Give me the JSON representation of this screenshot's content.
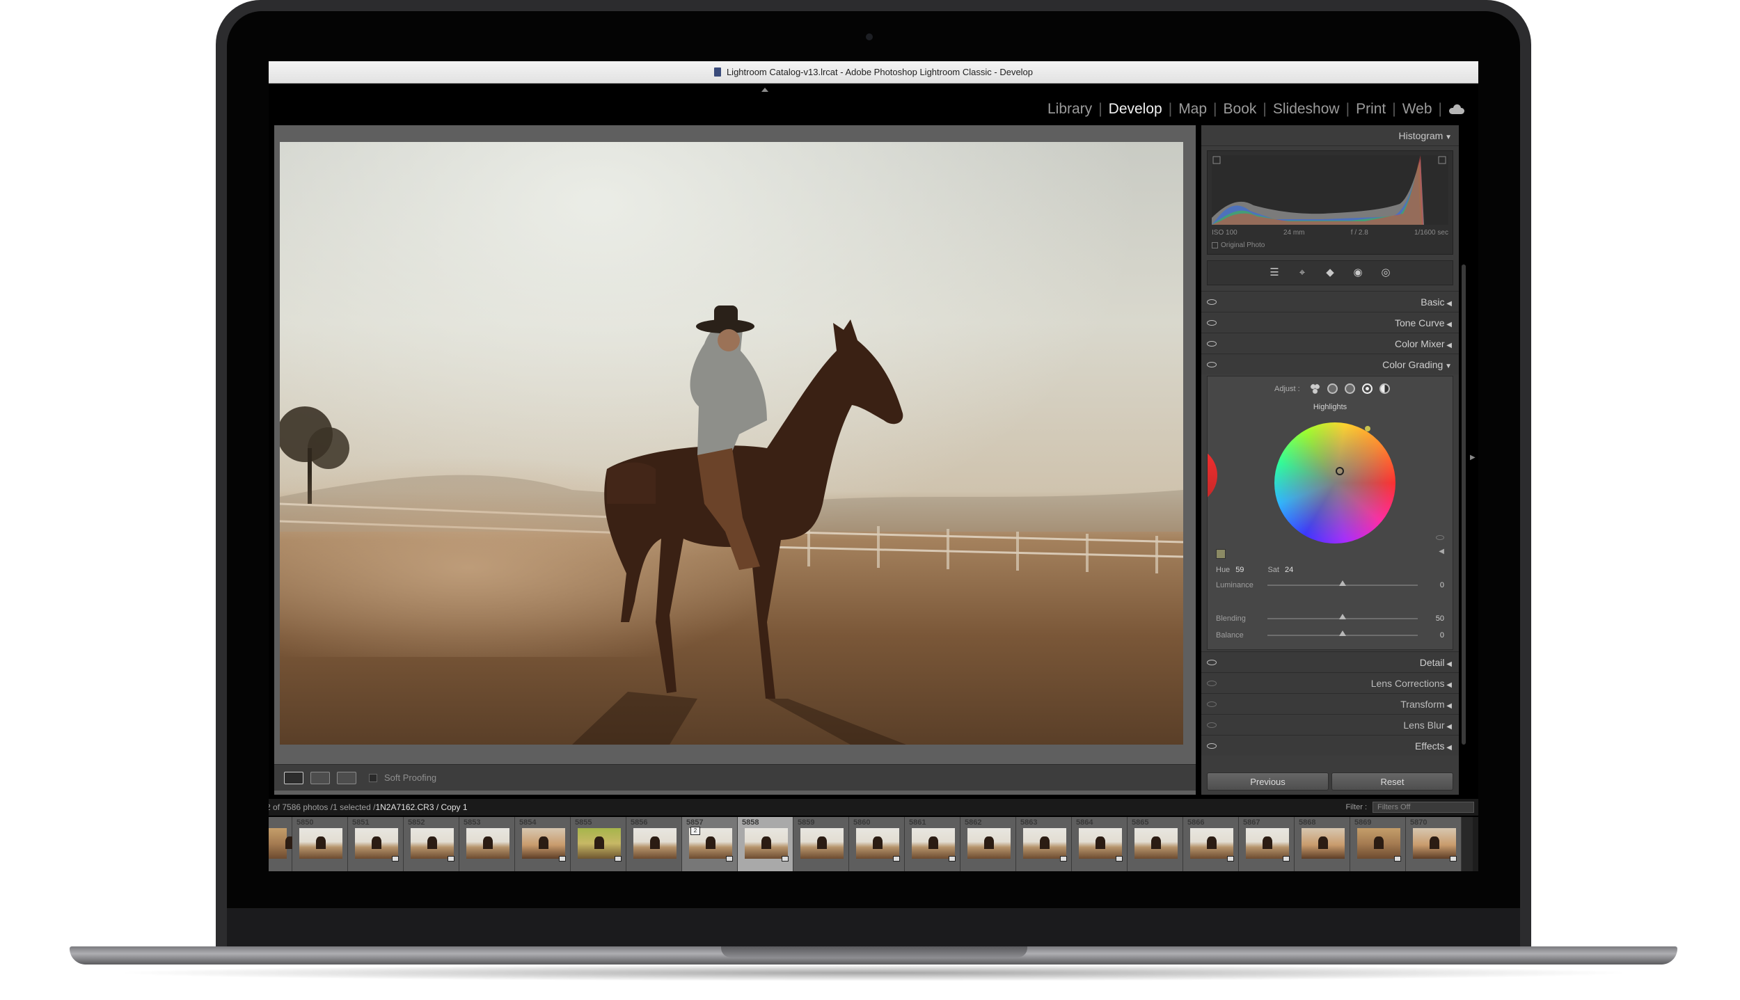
{
  "window": {
    "title": "Lightroom Catalog-v13.lrcat - Adobe Photoshop Lightroom Classic - Develop"
  },
  "modules": {
    "items": [
      "Library",
      "Develop",
      "Map",
      "Book",
      "Slideshow",
      "Print",
      "Web"
    ],
    "active": "Develop",
    "cloud_icon": "cloud-icon"
  },
  "toolbar": {
    "soft_proofing_label": "Soft Proofing",
    "soft_proofing_checked": false
  },
  "histogram": {
    "title": "Histogram",
    "iso": "ISO 100",
    "focal_length": "24 mm",
    "aperture": "f / 2.8",
    "shutter": "1/1600 sec",
    "original_photo_label": "Original Photo"
  },
  "tools": [
    "sliders-icon",
    "crop-icon",
    "eraser-icon",
    "red-eye-icon",
    "masking-icon"
  ],
  "sections_top": [
    {
      "title": "Basic",
      "state": "collapsed"
    },
    {
      "title": "Tone Curve",
      "state": "collapsed"
    },
    {
      "title": "Color Mixer",
      "state": "collapsed"
    },
    {
      "title": "Color Grading",
      "state": "expanded"
    }
  ],
  "color_grading": {
    "adjust_label": "Adjust :",
    "mode_label": "Highlights",
    "hue_label": "Hue",
    "hue_value": "59",
    "sat_label": "Sat",
    "sat_value": "24",
    "luminance_label": "Luminance",
    "luminance_value": "0",
    "luminance_pos": 0.5,
    "blending_label": "Blending",
    "blending_value": "50",
    "blending_pos": 0.5,
    "balance_label": "Balance",
    "balance_value": "0",
    "balance_pos": 0.5,
    "swatch_color": "#8b8a64"
  },
  "sections_bottom": [
    {
      "title": "Detail",
      "state": "collapsed"
    },
    {
      "title": "Lens Corrections",
      "state": "collapsed"
    },
    {
      "title": "Transform",
      "state": "collapsed"
    },
    {
      "title": "Lens Blur",
      "state": "collapsed"
    },
    {
      "title": "Effects",
      "state": "collapsed"
    }
  ],
  "panel_buttons": {
    "previous": "Previous",
    "reset": "Reset"
  },
  "filmstrip": {
    "path_prefix": "2 of 7586 photos /1 selected /",
    "filename": "1N2A7162.CR3 / Copy 1",
    "filter_label": "Filter :",
    "filter_value": "Filters Off",
    "cells": [
      "",
      "5850",
      "5851",
      "5852",
      "5853",
      "5854",
      "5855",
      "5856",
      "5857",
      "5858",
      "5859",
      "5860",
      "5861",
      "5862",
      "5863",
      "5864",
      "5865",
      "5866",
      "5867",
      "5868",
      "5869",
      "5870"
    ],
    "selected_index": 9,
    "stack_badge": "2"
  }
}
